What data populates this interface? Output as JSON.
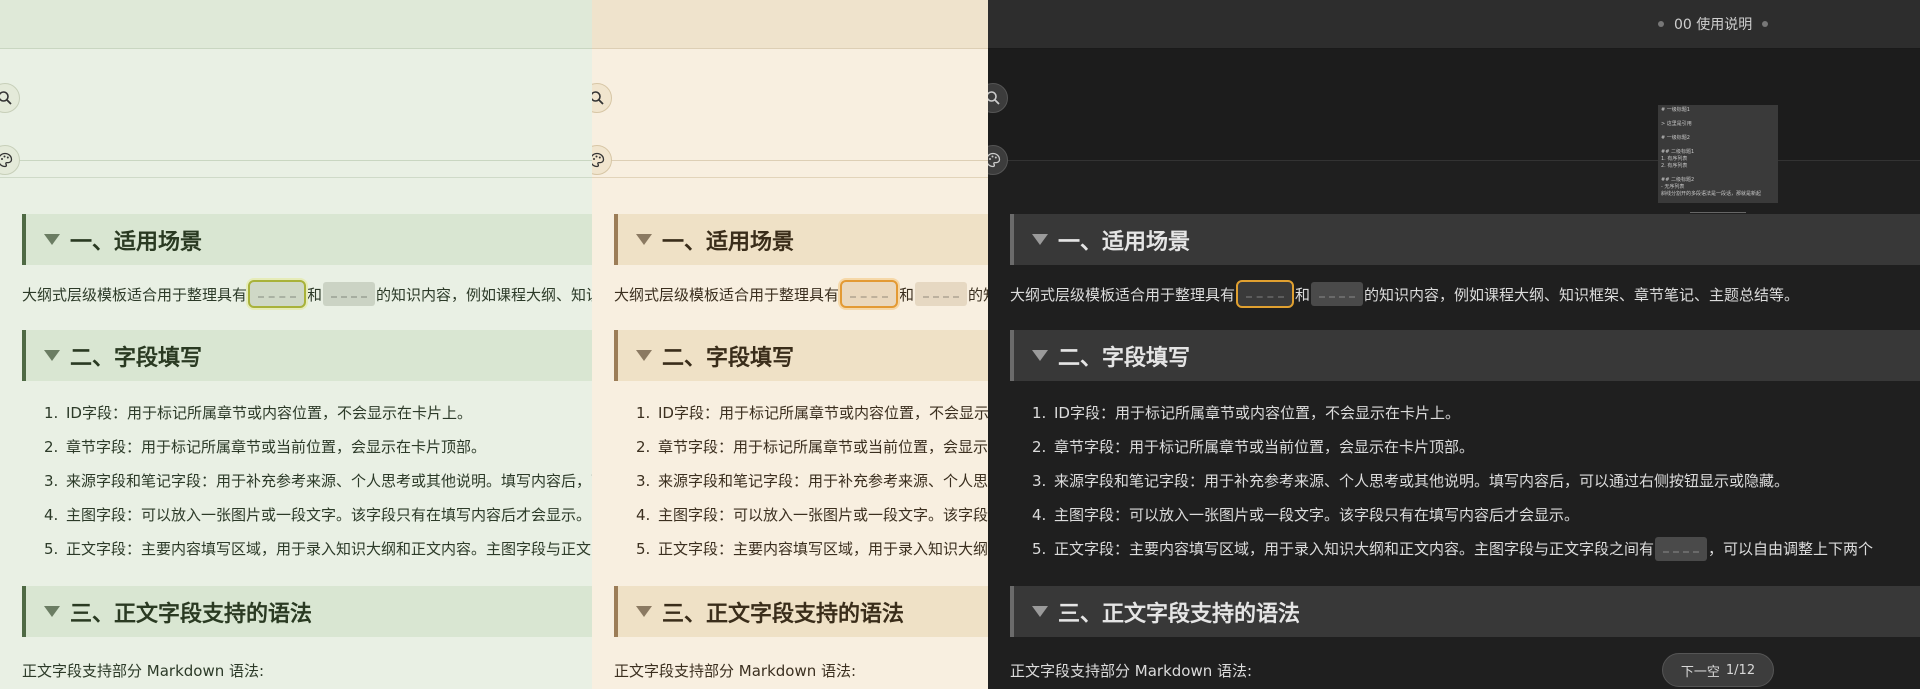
{
  "header": {
    "title": "00 使用说明"
  },
  "headings": {
    "h1": "一、适用场景",
    "h2": "二、字段填写",
    "h3": "三、正文字段支持的语法"
  },
  "intro": {
    "before": "大纲式层级模板适合用于整理具有",
    "middle": "和",
    "after": "的知识内容，例如课程大纲、知识框架、章节笔记、主题总结等。"
  },
  "fields": [
    {
      "num": "1.",
      "text": "ID字段：用于标记所属章节或内容位置，不会显示在卡片上。"
    },
    {
      "num": "2.",
      "text": "章节字段：用于标记所属章节或当前位置，会显示在卡片顶部。"
    },
    {
      "num": "3.",
      "text": "来源字段和笔记字段：用于补充参考来源、个人思考或其他说明。填写内容后，可以通过右侧按钮显示或隐藏。"
    },
    {
      "num": "4.",
      "text": "主图字段：可以放入一张图片或一段文字。该字段只有在填写内容后才会显示。"
    },
    {
      "num": "5.",
      "text_before": "正文字段：主要内容填写区域，用于录入知识大纲和正文内容。主图字段与正文字段之间有",
      "text_after": "，可以自由调整上下两个"
    }
  ],
  "syntax_intro": "正文字段支持部分 Markdown 语法:",
  "minimap": {
    "lines": [
      "# 一级标题1",
      "",
      "> 这里是引用",
      "",
      "# 一级标题2",
      "",
      "## 二级标题1",
      "1. 有序列表",
      "2. 有序列表",
      "",
      "## 二级标题2",
      "- 无序列表",
      "斜线分割开的多段语法是一段话，那就是新起"
    ]
  },
  "next_button": {
    "label": "下一空",
    "count": "1/12"
  },
  "colors": {
    "green_theme_accent": "#4f6a44",
    "cream_theme_accent": "#9c7d57",
    "dark_theme_accent": "#6b6b6b",
    "active_cloze_green": "#a8b23a",
    "active_cloze_orange": "#e39a34"
  },
  "icons": {
    "search": "search-icon",
    "palette": "palette-icon"
  }
}
